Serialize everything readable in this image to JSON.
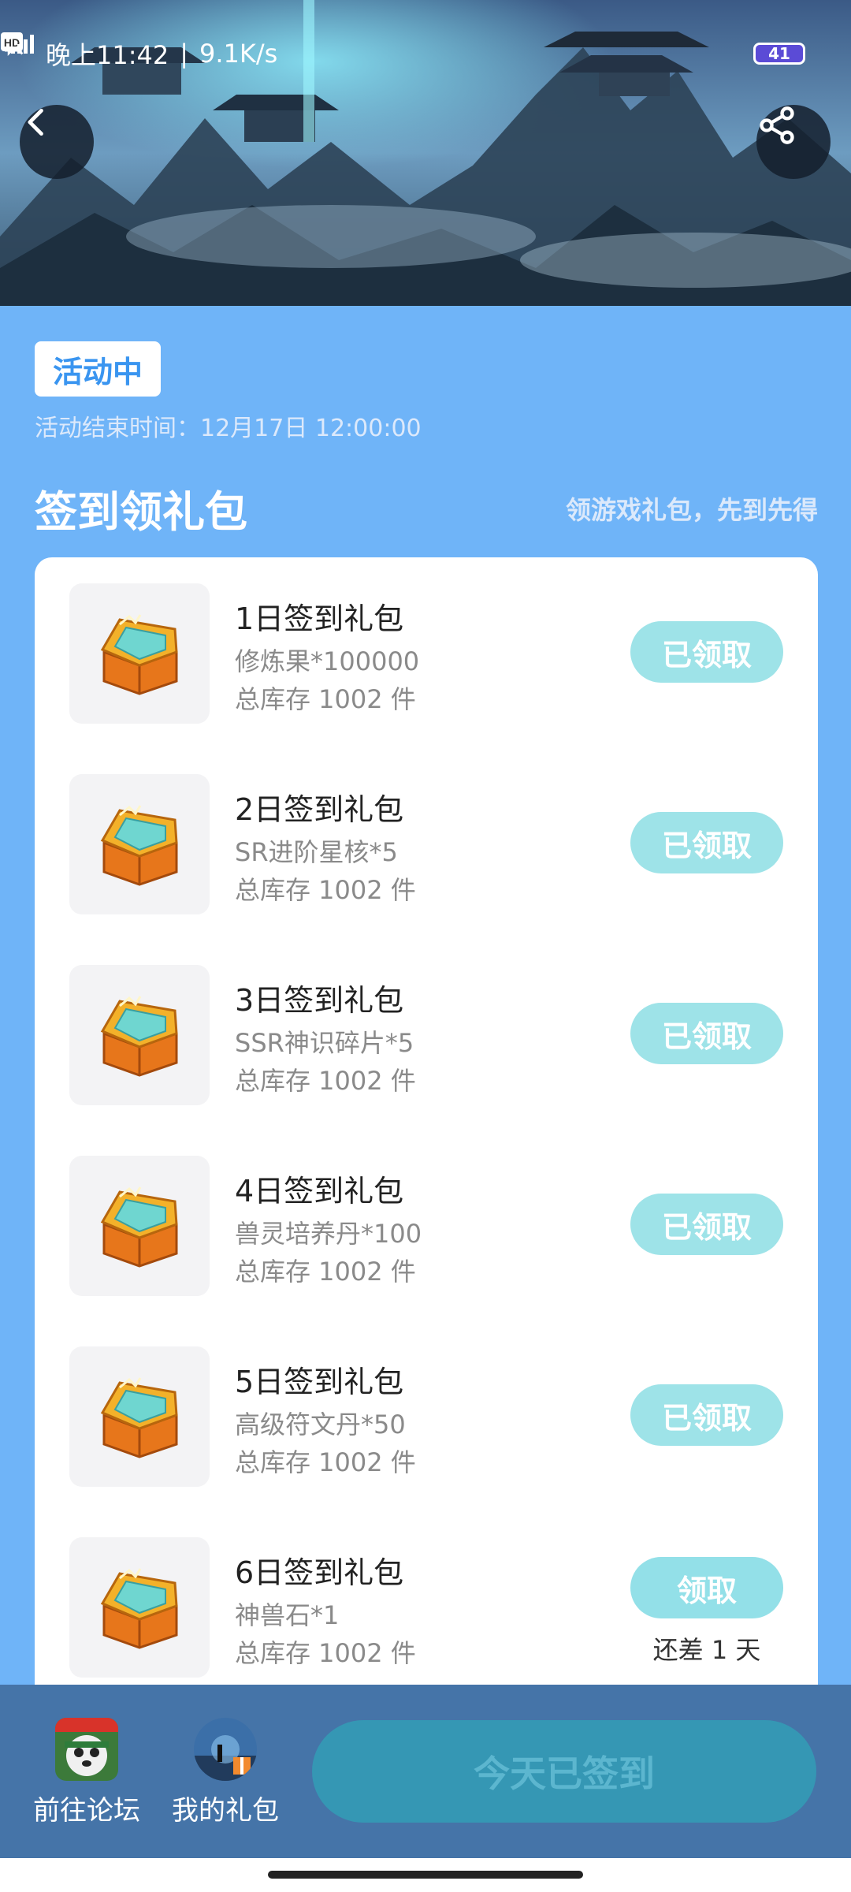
{
  "status_bar": {
    "time": "晚上11:42",
    "net_speed": "9.1K/s",
    "battery": "41"
  },
  "activity": {
    "status_tag": "活动中",
    "end_time_label": "活动结束时间：",
    "end_time_value": "12月17日 12:00:00"
  },
  "section": {
    "title": "签到领礼包",
    "subtitle": "领游戏礼包，先到先得"
  },
  "gifts": [
    {
      "title": "1日签到礼包",
      "item": "修炼果*100000",
      "stock": "总库存 1002 件",
      "button": "已领取",
      "claimed": true
    },
    {
      "title": "2日签到礼包",
      "item": "SR进阶星核*5",
      "stock": "总库存 1002 件",
      "button": "已领取",
      "claimed": true
    },
    {
      "title": "3日签到礼包",
      "item": "SSR神识碎片*5",
      "stock": "总库存 1002 件",
      "button": "已领取",
      "claimed": true
    },
    {
      "title": "4日签到礼包",
      "item": "兽灵培养丹*100",
      "stock": "总库存 1002 件",
      "button": "已领取",
      "claimed": true
    },
    {
      "title": "5日签到礼包",
      "item": "高级符文丹*50",
      "stock": "总库存 1002 件",
      "button": "已领取",
      "claimed": true
    },
    {
      "title": "6日签到礼包",
      "item": "神兽石*1",
      "stock": "总库存 1002 件",
      "button": "领取",
      "claimed": false,
      "note": "还差 1 天"
    }
  ],
  "bottom_nav": {
    "forum_label": "前往论坛",
    "gifts_label": "我的礼包",
    "signin_button": "今天已签到"
  },
  "icons": {
    "back": "back-arrow-icon",
    "share": "share-icon",
    "gift": "treasure-chest-icon"
  },
  "colors": {
    "page_bg": "#6FB4F8",
    "accent": "#3a95f0",
    "claim_button": "#9ee3e8",
    "bottom_bar": "#4574a8",
    "signin_button": "#3597b4"
  }
}
